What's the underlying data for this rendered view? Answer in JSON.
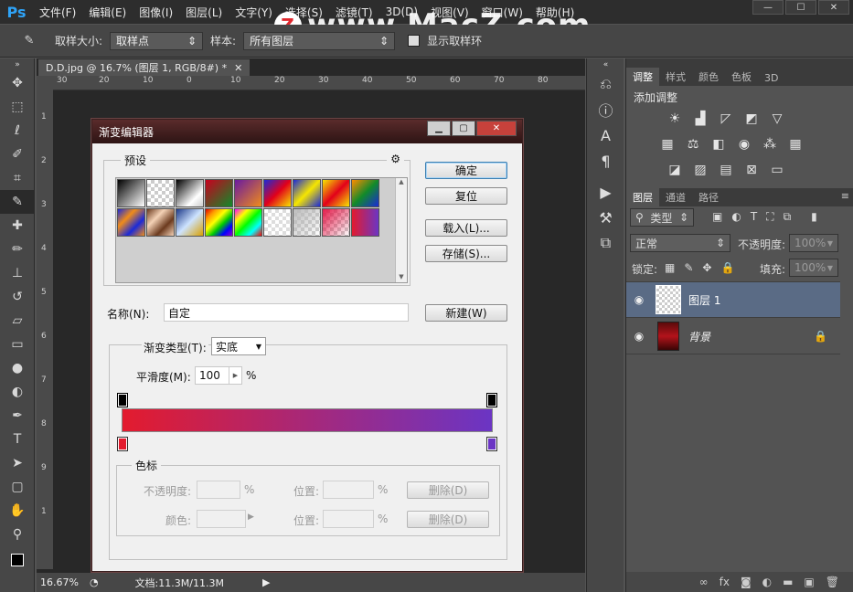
{
  "app": {
    "logo": "Ps",
    "menu": [
      "文件(F)",
      "编辑(E)",
      "图像(I)",
      "图层(L)",
      "文字(Y)",
      "选择(S)",
      "滤镜(T)",
      "3D(D)",
      "视图(V)",
      "窗口(W)",
      "帮助(H)"
    ],
    "window_buttons": [
      "—",
      "☐",
      "✕"
    ]
  },
  "watermark": {
    "logo": "Z",
    "text": "www.MacZ.com"
  },
  "options": {
    "sample_size_label": "取样大小:",
    "sample_size_value": "取样点",
    "sample_label": "样本:",
    "sample_value": "所有图层",
    "show_ring_label": "显示取样环"
  },
  "document": {
    "tab_title": "D.D.jpg @ 16.7% (图层 1, RGB/8#) *",
    "ruler_h": [
      "30",
      "20",
      "10",
      "0",
      "10",
      "20",
      "30",
      "40",
      "50",
      "60",
      "70",
      "80"
    ],
    "ruler_v": [
      "1",
      "2",
      "3",
      "4",
      "5",
      "6",
      "7",
      "8",
      "9",
      "1"
    ],
    "zoom": "16.67%",
    "doc_size": "文档:11.3M/11.3M"
  },
  "dialog": {
    "title": "渐变编辑器",
    "presets_label": "预设",
    "ok": "确定",
    "reset": "复位",
    "load": "载入(L)...",
    "save": "存储(S)...",
    "name_label": "名称(N):",
    "name_value": "自定",
    "new": "新建(W)",
    "gradient_type_label": "渐变类型(T):",
    "gradient_type_value": "实底",
    "smoothness_label": "平滑度(M):",
    "smoothness_value": "100",
    "smoothness_unit": "%",
    "color_stops_label": "色标",
    "opacity_label": "不透明度:",
    "opacity_unit": "%",
    "location_label": "位置:",
    "location_unit": "%",
    "delete": "删除(D)",
    "color_label": "颜色:",
    "gradient_colors": [
      "#e31b2e",
      "#6b35c4"
    ]
  },
  "adjustments": {
    "tabs": [
      "调整",
      "样式",
      "颜色",
      "色板",
      "3D"
    ],
    "title": "添加调整"
  },
  "layers": {
    "tabs": [
      "图层",
      "通道",
      "路径"
    ],
    "filter_label": "类型",
    "blend_mode": "正常",
    "opacity_label": "不透明度:",
    "opacity_value": "100%",
    "lock_label": "锁定:",
    "fill_label": "填充:",
    "fill_value": "100%",
    "items": [
      {
        "name": "图层 1"
      },
      {
        "name": "背景"
      }
    ]
  }
}
